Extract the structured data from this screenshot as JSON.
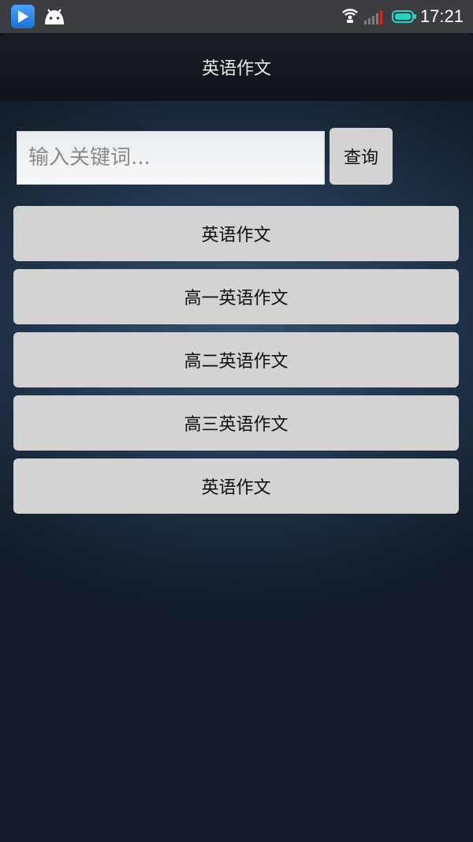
{
  "status_bar": {
    "time": "17:21",
    "icons": [
      "play-app-icon",
      "android-icon",
      "wifi-icon",
      "signal-icon",
      "battery-icon"
    ],
    "colors": {
      "battery": "#20d6c8",
      "signal_alert": "#e02020"
    }
  },
  "header": {
    "title": "英语作文"
  },
  "search": {
    "placeholder": "输入关键词...",
    "value": "",
    "button_label": "查询"
  },
  "menu": {
    "items": [
      {
        "label": "英语作文"
      },
      {
        "label": "高一英语作文"
      },
      {
        "label": "高二英语作文"
      },
      {
        "label": "高三英语作文"
      },
      {
        "label": "英语作文"
      }
    ]
  }
}
